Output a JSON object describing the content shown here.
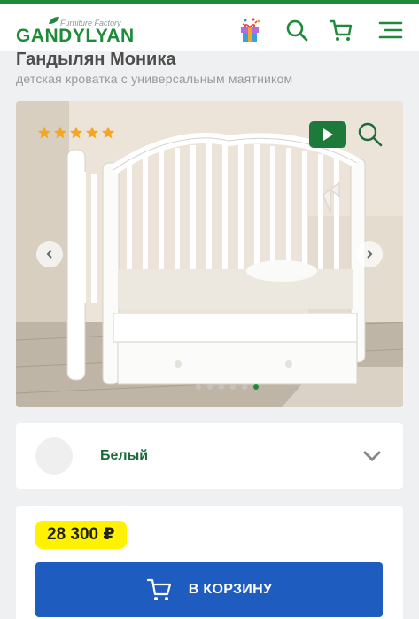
{
  "header": {
    "brand": "GANDYLYAN",
    "brand_subtitle": "Furniture Factory",
    "icons": [
      "gift-icon",
      "search-icon",
      "cart-icon",
      "menu-icon"
    ]
  },
  "product": {
    "title": "Гандылян Моника",
    "subtitle": "детская кроватка с универсальным маятником",
    "rating_stars": 5,
    "gallery": {
      "slide_count": 6,
      "active_slide": 6
    }
  },
  "options": {
    "color_label": "Белый"
  },
  "purchase": {
    "price": "28 300 ₽",
    "cart_button_label": "В КОРЗИНУ"
  },
  "colors": {
    "brand_green": "#1e8a3a",
    "price_highlight": "#fff200",
    "button_blue": "#1f5cc0"
  }
}
